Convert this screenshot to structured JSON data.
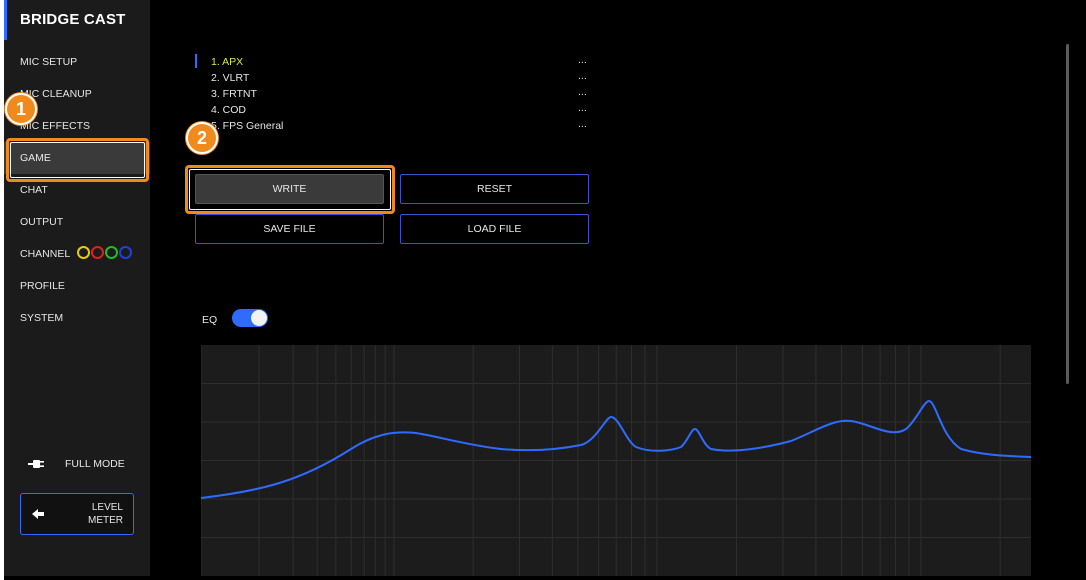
{
  "sidebar": {
    "brand": "BRIDGE CAST",
    "items": [
      {
        "label": "MIC SETUP"
      },
      {
        "label": "MIC CLEANUP"
      },
      {
        "label": "MIC EFFECTS"
      },
      {
        "label": "GAME"
      },
      {
        "label": "CHAT"
      },
      {
        "label": "OUTPUT"
      },
      {
        "label": "CHANNEL"
      },
      {
        "label": "PROFILE"
      },
      {
        "label": "SYSTEM"
      }
    ],
    "active_item": "GAME",
    "channel_ring_colors": [
      "#e8d000",
      "#e02020",
      "#20c020",
      "#2040e0"
    ],
    "full_mode_label": "FULL MODE",
    "level_meter_line1": "LEVEL",
    "level_meter_line2": "METER"
  },
  "presets": {
    "items": [
      {
        "label": "1. APX",
        "value": "..."
      },
      {
        "label": "2. VLRT",
        "value": "..."
      },
      {
        "label": "3. FRTNT",
        "value": "..."
      },
      {
        "label": "4. COD",
        "value": "..."
      },
      {
        "label": "5. FPS General",
        "value": "..."
      }
    ],
    "selected_index": 0
  },
  "buttons": {
    "write": "WRITE",
    "reset": "RESET",
    "save_file": "SAVE FILE",
    "load_file": "LOAD FILE"
  },
  "eq": {
    "label": "EQ",
    "enabled": true,
    "curve_color": "#2f6bff"
  },
  "annotations": {
    "badge1": "1",
    "badge2": "2",
    "highlight_color": "#f08a1c"
  },
  "colors": {
    "accent": "#2f6bff",
    "selected_preset": "#d8e94a",
    "sidebar_bg": "#1b1b1b"
  }
}
